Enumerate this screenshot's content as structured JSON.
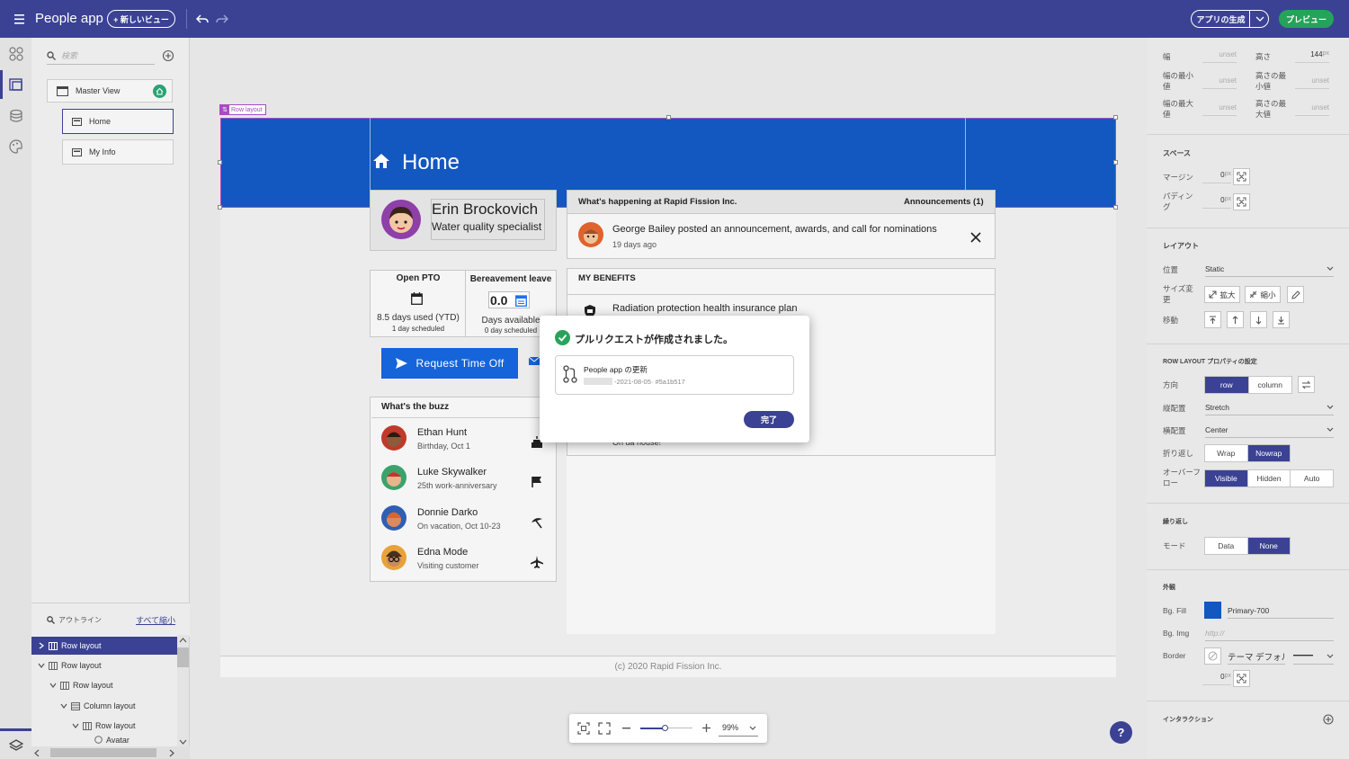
{
  "topbar": {
    "app_title": "People app",
    "new_view_label": "+ 新しいビュー",
    "generate_app_label": "アプリの生成",
    "preview_label": "プレビュー"
  },
  "left_panel": {
    "search_placeholder": "検索",
    "views": [
      {
        "label": "Master View"
      },
      {
        "label": "Home"
      },
      {
        "label": "My Info"
      }
    ],
    "outline_label": "アウトライン",
    "collapse_all_label": "すべて縮小",
    "tree": [
      {
        "label": "Row layout",
        "selected": true
      },
      {
        "label": "Row layout"
      },
      {
        "label": "Row layout"
      },
      {
        "label": "Column layout"
      },
      {
        "label": "Row layout"
      },
      {
        "label": "Avatar"
      }
    ]
  },
  "canvas": {
    "selection_tag": "Row layout",
    "page_title": "Home",
    "profile": {
      "name": "Erin Brockovich",
      "title": "Water quality specialist"
    },
    "pto": {
      "title": "Open PTO",
      "used": "8.5 days used (YTD)",
      "scheduled": "1 day scheduled"
    },
    "bereavement": {
      "title": "Bereavement leave",
      "value": "0.0",
      "available": "Days available",
      "scheduled": "0 day scheduled"
    },
    "request_button": "Request Time Off",
    "buzz": {
      "title": "What's the buzz",
      "people": [
        {
          "name": "Ethan Hunt",
          "sub": "Birthday, Oct 1",
          "icon": "cake-icon"
        },
        {
          "name": "Luke Skywalker",
          "sub": "25th work-anniversary",
          "icon": "flag-icon"
        },
        {
          "name": "Donnie Darko",
          "sub": "On vacation, Oct 10-23",
          "icon": "beach-umbrella-icon"
        },
        {
          "name": "Edna Mode",
          "sub": "Visiting customer",
          "icon": "airplane-icon"
        }
      ]
    },
    "announcements": {
      "title": "What's happening at Rapid Fission Inc.",
      "count": "Announcements (1)",
      "text": "George Bailey posted an announcement, awards, and call for nominations",
      "time": "19 days ago"
    },
    "benefits": {
      "title": "MY BENEFITS",
      "item": "Radiation protection health insurance plan",
      "more": "On da house!"
    },
    "footer": "(c) 2020 Rapid Fission Inc."
  },
  "modal": {
    "title": "プルリクエストが作成されました。",
    "pr_title": "People app の更新",
    "pr_date": "-2021-08-05",
    "pr_hash": " · #5a1b517",
    "done_label": "完了"
  },
  "zoom": {
    "value": "99%",
    "level_percent": 99
  },
  "right_panel": {
    "width_label": "幅",
    "width_value": "unset",
    "height_label": "高さ",
    "height_value": "144",
    "min_width_label": "幅の最小値",
    "min_width_value": "unset",
    "min_height_label": "高さの最小値",
    "min_height_value": "unset",
    "max_width_label": "幅の最大値",
    "max_width_value": "unset",
    "max_height_label": "高さの最大値",
    "max_height_value": "unset",
    "px_unit": "px",
    "space_section": "スペース",
    "margin_label": "マージン",
    "margin_value": "0",
    "padding_label": "パディング",
    "padding_value": "0",
    "layout_section": "レイアウト",
    "position_label": "位置",
    "position_value": "Static",
    "resize_label": "サイズ変更",
    "grow_label": "拡大",
    "shrink_label": "縮小",
    "move_label": "移動",
    "row_props_section": "ROW LAYOUT プロパティの設定",
    "direction_label": "方向",
    "direction_options": [
      "row",
      "column"
    ],
    "vertical_align_label": "縦配置",
    "vertical_align_value": "Stretch",
    "horizontal_align_label": "横配置",
    "horizontal_align_value": "Center",
    "wrap_label": "折り返し",
    "wrap_options": [
      "Wrap",
      "Nowrap"
    ],
    "overflow_label": "オーバーフロー",
    "overflow_options": [
      "Visible",
      "Hidden",
      "Auto"
    ],
    "repeat_section": "繰り返し",
    "mode_label": "モード",
    "mode_options": [
      "Data",
      "None"
    ],
    "appearance_section": "外観",
    "bg_fill_label": "Bg. Fill",
    "bg_fill_value": "Primary-700",
    "bg_fill_color": "#1357c0",
    "bg_img_label": "Bg. Img",
    "bg_img_placeholder": "http://",
    "border_label": "Border",
    "border_value": "テーマ デフォル",
    "border_width": "0",
    "interaction_section": "インタラクション"
  }
}
